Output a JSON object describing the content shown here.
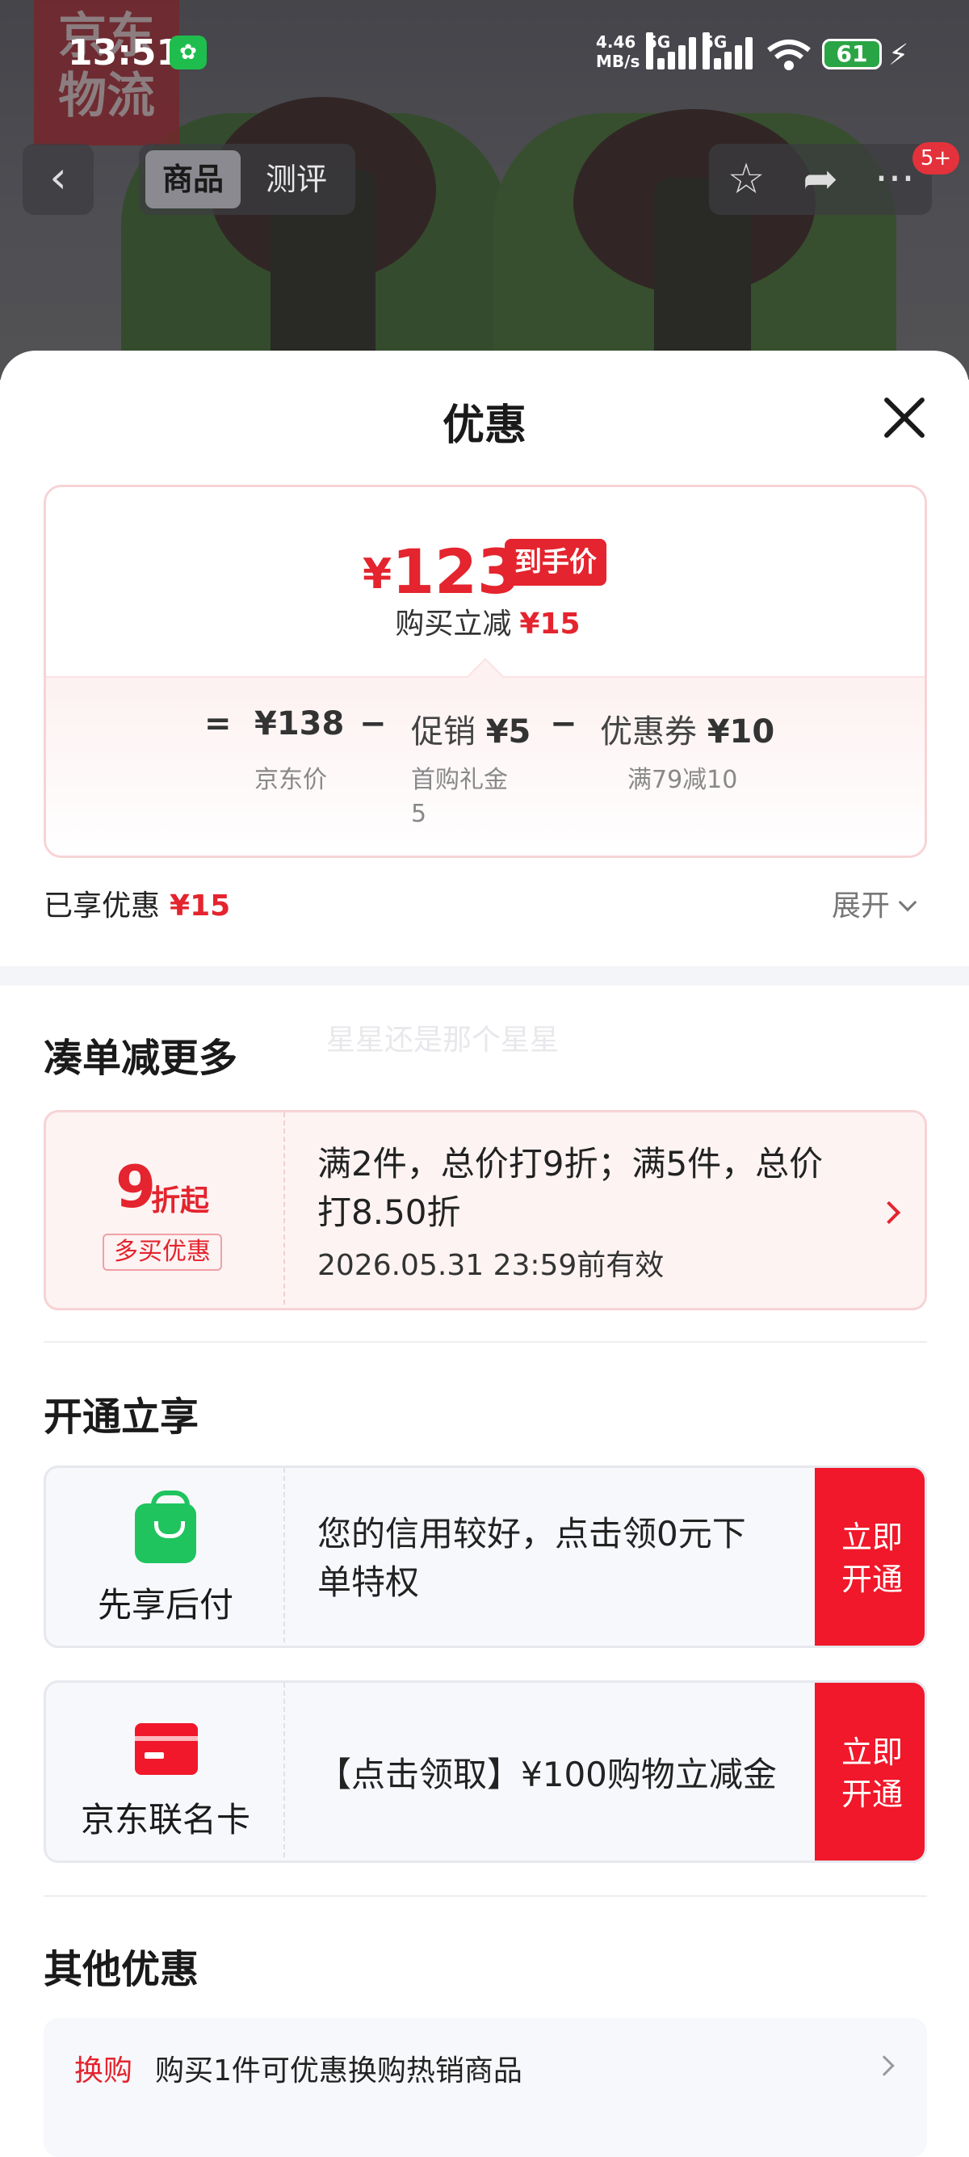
{
  "status_bar": {
    "time": "13:51",
    "net_speed": "4.46",
    "net_unit": "MB/s",
    "sig1_label": "5G",
    "sig2_label": "5G",
    "battery": "61",
    "wechat_icon": "wechat-icon"
  },
  "background": {
    "brand_line1": "京东",
    "brand_line2": "物流"
  },
  "nav": {
    "tab_goods": "商品",
    "tab_review": "测评",
    "badge": "5+"
  },
  "sheet": {
    "title": "优惠"
  },
  "price_card": {
    "yen": "¥",
    "final_price": "123",
    "final_tag": "到手价",
    "save_label": "购买立减",
    "save_amount": "¥15",
    "eq": "=",
    "minus": "−",
    "items": [
      {
        "value": "¥138",
        "label": "京东价",
        "sub": ""
      },
      {
        "value_prefix": "促销",
        "value": "¥5",
        "label": "首购礼金",
        "sub": "5"
      },
      {
        "value_prefix": "优惠券",
        "value": "¥10",
        "label": "满79减10",
        "sub": ""
      }
    ]
  },
  "enjoyed": {
    "label": "已享优惠",
    "amount": "¥15",
    "expand": "展开"
  },
  "section_bundle": {
    "title": "凑单减更多",
    "watermark": "星星还是那个星星",
    "card": {
      "big": "9",
      "big_suffix": "折起",
      "tag": "多买优惠",
      "line1": "满2件，总价打9折；满5件，总价",
      "line2": "打8.50折",
      "deadline": "2026.05.31 23:59前有效"
    }
  },
  "section_open": {
    "title": "开通立享",
    "cards": [
      {
        "name": "先享后付",
        "line1": "您的信用较好，点击领0元下",
        "line2": "单特权",
        "btn1": "立即",
        "btn2": "开通"
      },
      {
        "name": "京东联名卡",
        "line1": "【点击领取】¥100购物立减金",
        "line2": "",
        "btn1": "立即",
        "btn2": "开通"
      }
    ]
  },
  "section_other": {
    "title": "其他优惠",
    "item_label": "换购",
    "item_text": "购买1件可优惠换购热销商品"
  },
  "colors": {
    "accent_red": "#e4242e",
    "button_red": "#f0182a",
    "green": "#1fc45f"
  }
}
